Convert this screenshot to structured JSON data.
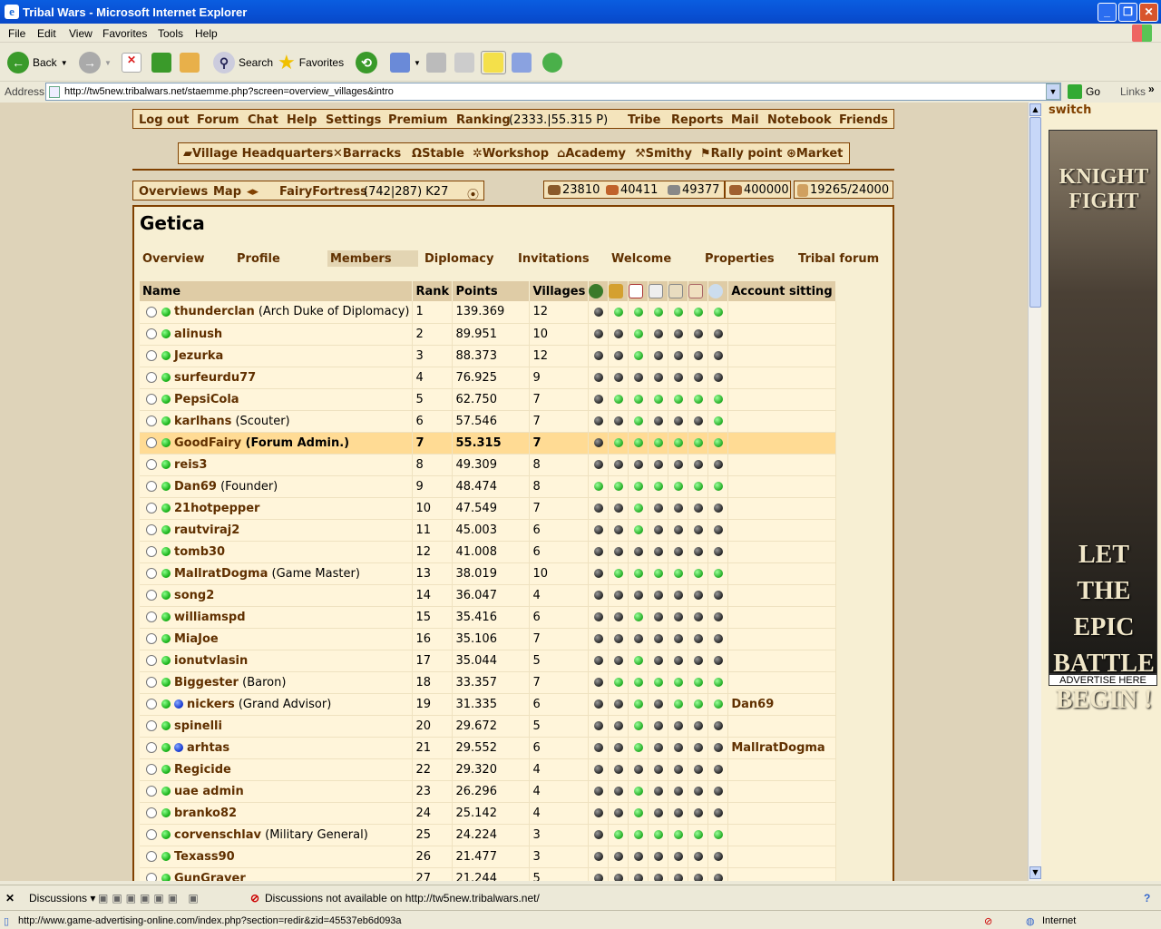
{
  "window": {
    "title": "Tribal Wars - Microsoft Internet Explorer"
  },
  "menu": [
    "File",
    "Edit",
    "View",
    "Favorites",
    "Tools",
    "Help"
  ],
  "toolbar": {
    "back": "Back",
    "search": "Search",
    "favorites": "Favorites"
  },
  "address": {
    "label": "Address",
    "url": "http://tw5new.tribalwars.net/staemme.php?screen=overview_villages&intro",
    "go": "Go",
    "links": "Links"
  },
  "top_menu": {
    "logout": "Log out",
    "forum": "Forum",
    "chat": "Chat",
    "help": "Help",
    "settings": "Settings",
    "premium": "Premium",
    "ranking": "Ranking",
    "ranking_info": "(2333.|55.315 P)",
    "tribe": "Tribe",
    "reports": "Reports",
    "mail": "Mail",
    "notebook": "Notebook",
    "friends": "Friends"
  },
  "buildings": [
    "Village Headquarters",
    "Barracks",
    "Stable",
    "Workshop",
    "Academy",
    "Smithy",
    "Rally point",
    "Market"
  ],
  "village_bar": {
    "overviews": "Overviews",
    "map": "Map",
    "village": "FairyFortress",
    "coords": "(742|287) K27"
  },
  "resources": {
    "wood": "23810",
    "clay": "40411",
    "iron": "49377",
    "storage": "400000",
    "farm": "19265/24000"
  },
  "tribe": {
    "name": "Getica"
  },
  "tabs": [
    "Overview",
    "Profile",
    "Members",
    "Diplomacy",
    "Invitations",
    "Welcome",
    "Properties",
    "Tribal forum"
  ],
  "selected_tab": "Members",
  "table": {
    "headers": {
      "name": "Name",
      "rank": "Rank",
      "points": "Points",
      "villages": "Villages",
      "sitting": "Account sitting"
    },
    "rows": [
      {
        "name": "thunderclan",
        "title": "(Arch Duke of Diplomacy)",
        "rank": "1",
        "points": "139.369",
        "villages": "12",
        "dots": "kggggggg",
        "sit": "",
        "blue": false
      },
      {
        "name": "alinush",
        "title": "",
        "rank": "2",
        "points": "89.951",
        "villages": "10",
        "dots": "kkgkkkk",
        "sit": "",
        "blue": false
      },
      {
        "name": "Jezurka",
        "title": "",
        "rank": "3",
        "points": "88.373",
        "villages": "12",
        "dots": "kkgkkkk",
        "sit": "",
        "blue": false
      },
      {
        "name": "surfeurdu77",
        "title": "",
        "rank": "4",
        "points": "76.925",
        "villages": "9",
        "dots": "kkkkkkk",
        "sit": "",
        "blue": false
      },
      {
        "name": "PepsiCola",
        "title": "",
        "rank": "5",
        "points": "62.750",
        "villages": "7",
        "dots": "kgggggg",
        "sit": "",
        "blue": false
      },
      {
        "name": "karlhans",
        "title": "(Scouter)",
        "rank": "6",
        "points": "57.546",
        "villages": "7",
        "dots": "kkgkkkg",
        "sit": "",
        "blue": false
      },
      {
        "name": "GoodFairy",
        "title": "(Forum Admin.)",
        "rank": "7",
        "points": "55.315",
        "villages": "7",
        "dots": "kgggggg",
        "sit": "",
        "blue": false,
        "me": true
      },
      {
        "name": "reis3",
        "title": "",
        "rank": "8",
        "points": "49.309",
        "villages": "8",
        "dots": "kkkkkkk",
        "sit": "",
        "blue": false
      },
      {
        "name": "Dan69",
        "title": "(Founder)",
        "rank": "9",
        "points": "48.474",
        "villages": "8",
        "dots": "ggggggg",
        "sit": "",
        "blue": false
      },
      {
        "name": "21hotpepper",
        "title": "",
        "rank": "10",
        "points": "47.549",
        "villages": "7",
        "dots": "kkgkkkk",
        "sit": "",
        "blue": false
      },
      {
        "name": "rautviraj2",
        "title": "",
        "rank": "11",
        "points": "45.003",
        "villages": "6",
        "dots": "kkgkkkk",
        "sit": "",
        "blue": false
      },
      {
        "name": "tomb30",
        "title": "",
        "rank": "12",
        "points": "41.008",
        "villages": "6",
        "dots": "kkkkkkk",
        "sit": "",
        "blue": false
      },
      {
        "name": "MallratDogma",
        "title": "(Game Master)",
        "rank": "13",
        "points": "38.019",
        "villages": "10",
        "dots": "kgggggg",
        "sit": "",
        "blue": false
      },
      {
        "name": "song2",
        "title": "",
        "rank": "14",
        "points": "36.047",
        "villages": "4",
        "dots": "kkkkkkk",
        "sit": "",
        "blue": false
      },
      {
        "name": "williamspd",
        "title": "",
        "rank": "15",
        "points": "35.416",
        "villages": "6",
        "dots": "kkgkkkk",
        "sit": "",
        "blue": false
      },
      {
        "name": "MiaJoe",
        "title": "",
        "rank": "16",
        "points": "35.106",
        "villages": "7",
        "dots": "kkkkkkk",
        "sit": "",
        "blue": false
      },
      {
        "name": "ionutvlasin",
        "title": "",
        "rank": "17",
        "points": "35.044",
        "villages": "5",
        "dots": "kkgkkkk",
        "sit": "",
        "blue": false
      },
      {
        "name": "Biggester",
        "title": "(Baron)",
        "rank": "18",
        "points": "33.357",
        "villages": "7",
        "dots": "kgggggg",
        "sit": "",
        "blue": false
      },
      {
        "name": "nickers",
        "title": "(Grand Advisor)",
        "rank": "19",
        "points": "31.335",
        "villages": "6",
        "dots": "kkgkggg",
        "sit": "Dan69",
        "blue": true
      },
      {
        "name": "spinelli",
        "title": "",
        "rank": "20",
        "points": "29.672",
        "villages": "5",
        "dots": "kkgkkkk",
        "sit": "",
        "blue": false
      },
      {
        "name": "arhtas",
        "title": "",
        "rank": "21",
        "points": "29.552",
        "villages": "6",
        "dots": "kkgkkkk",
        "sit": "MallratDogma",
        "blue": true
      },
      {
        "name": "Regicide",
        "title": "",
        "rank": "22",
        "points": "29.320",
        "villages": "4",
        "dots": "kkkkkkk",
        "sit": "",
        "blue": false
      },
      {
        "name": "uae admin",
        "title": "",
        "rank": "23",
        "points": "26.296",
        "villages": "4",
        "dots": "kkgkkkk",
        "sit": "",
        "blue": false
      },
      {
        "name": "branko82",
        "title": "",
        "rank": "24",
        "points": "25.142",
        "villages": "4",
        "dots": "kkgkkkk",
        "sit": "",
        "blue": false
      },
      {
        "name": "corvenschlav",
        "title": "(Military General)",
        "rank": "25",
        "points": "24.224",
        "villages": "3",
        "dots": "kgggggg",
        "sit": "",
        "blue": false
      },
      {
        "name": "Texass90",
        "title": "",
        "rank": "26",
        "points": "21.477",
        "villages": "3",
        "dots": "kkkkkkk",
        "sit": "",
        "blue": false
      },
      {
        "name": "GunGraver",
        "title": "",
        "rank": "27",
        "points": "21.244",
        "villages": "5",
        "dots": "kkkkkkk",
        "sit": "",
        "blue": false
      }
    ]
  },
  "ad": {
    "switch": "switch",
    "banner_top": "KNIGHT FIGHT",
    "banner_bottom": "LET THE EPIC BATTLE BEGIN !",
    "advertise": "ADVERTISE HERE"
  },
  "discussions": {
    "label": "Discussions",
    "status": "Discussions not available on http://tw5new.tribalwars.net/"
  },
  "status": {
    "url": "http://www.game-advertising-online.com/index.php?section=redir&zid=45537eb6d093a",
    "zone": "Internet"
  }
}
